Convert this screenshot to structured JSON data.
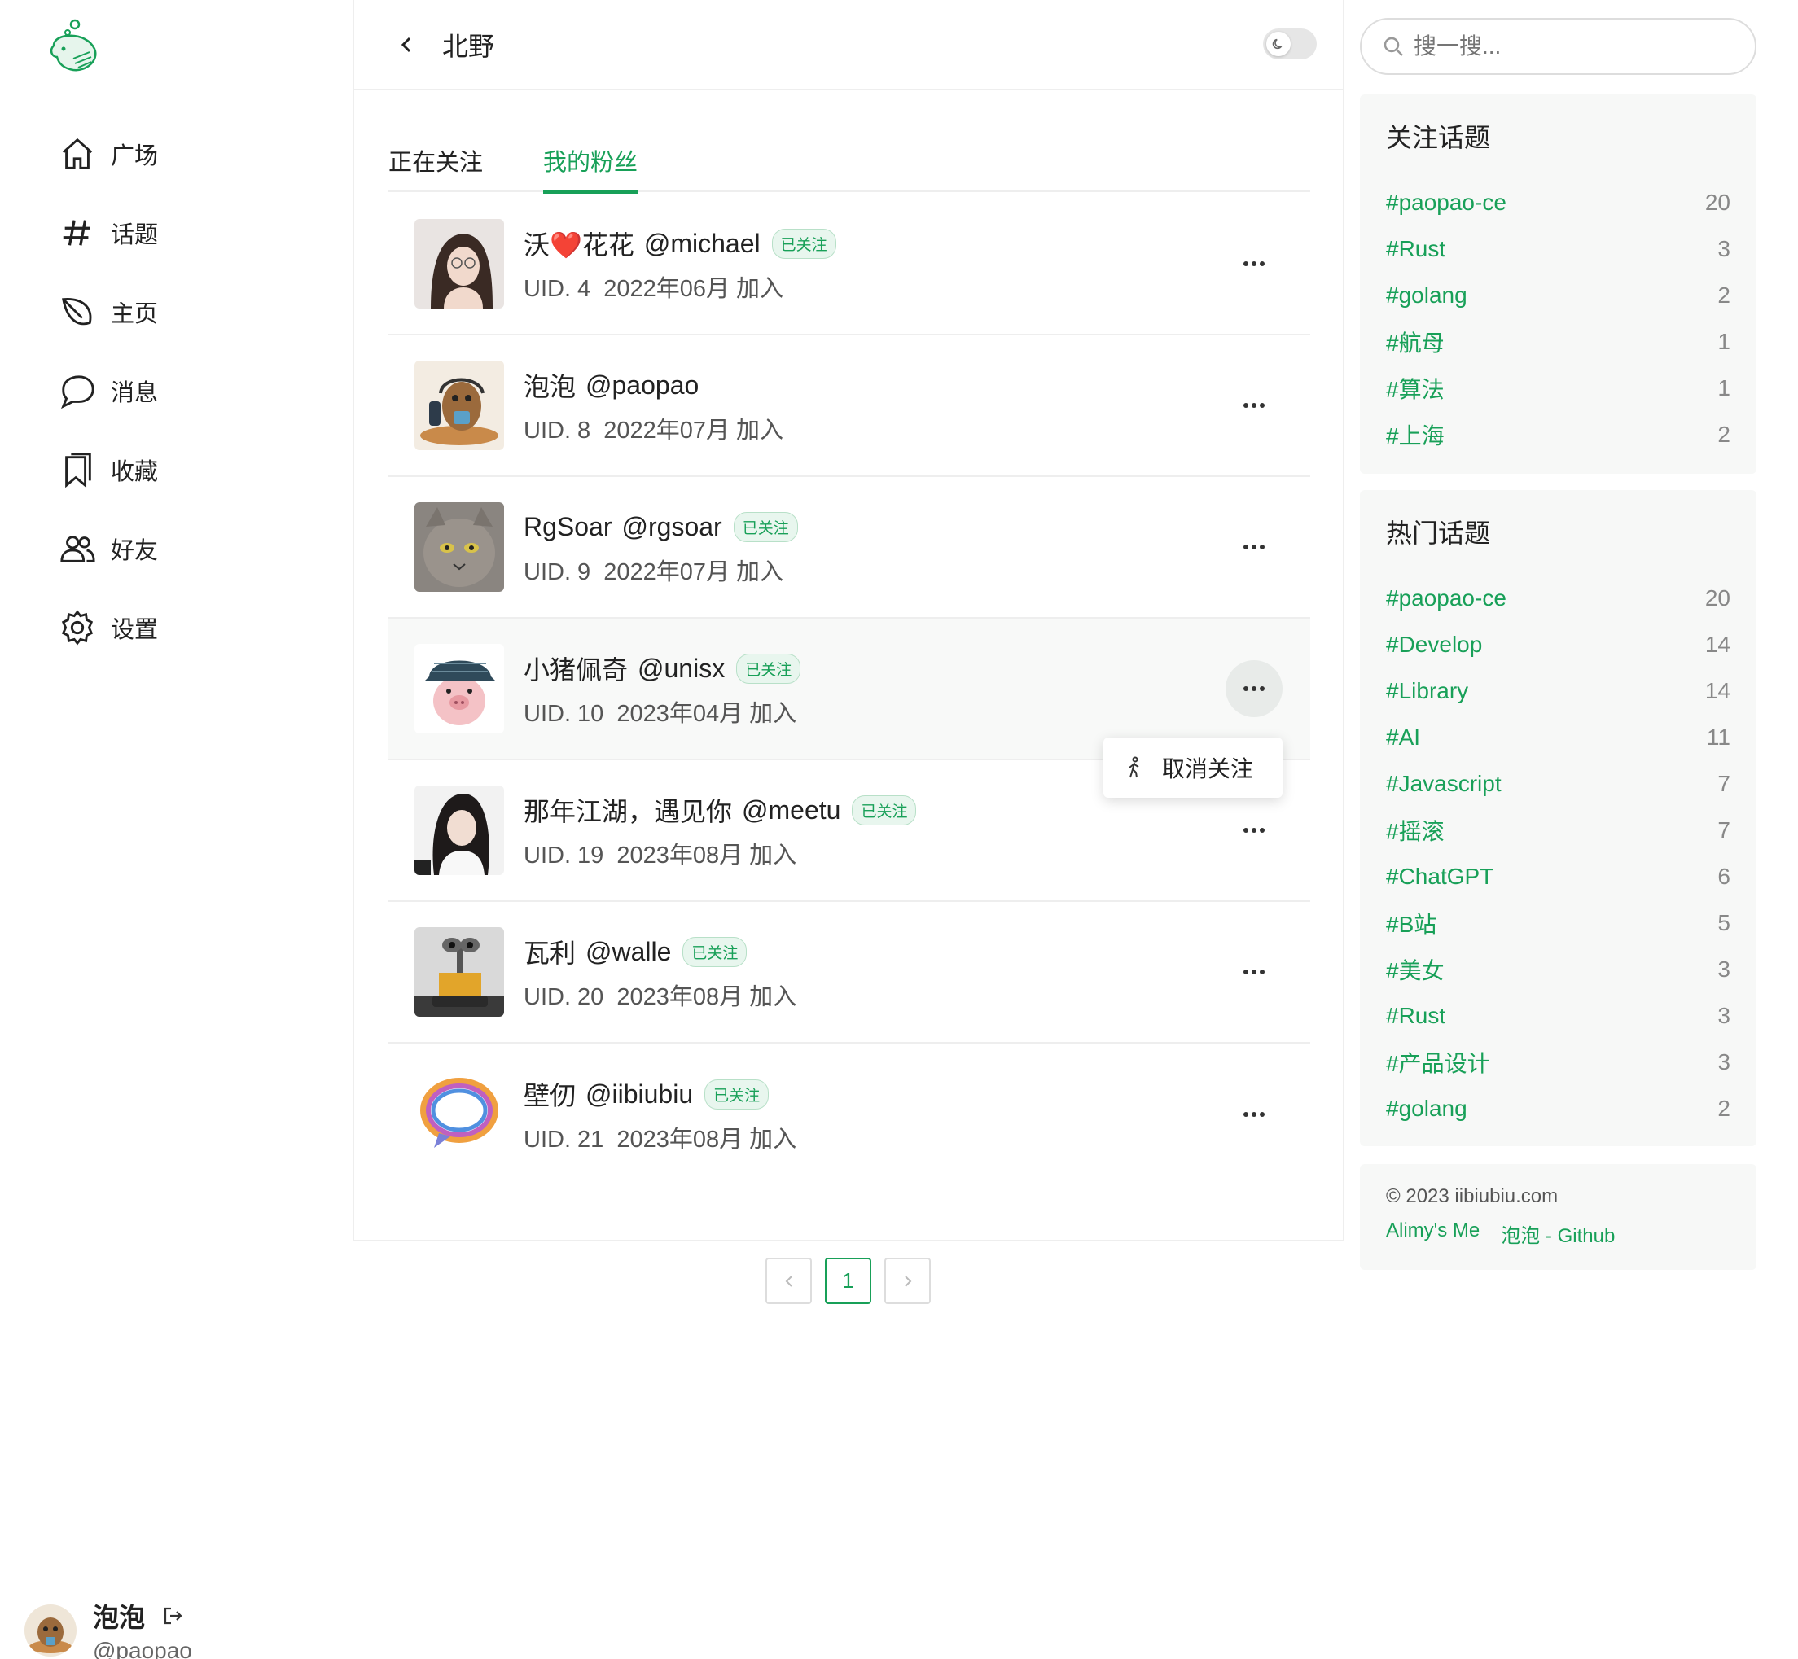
{
  "sidebar": {
    "nav": [
      {
        "label": "广场",
        "icon": "home-icon"
      },
      {
        "label": "话题",
        "icon": "hash-icon"
      },
      {
        "label": "主页",
        "icon": "leaf-icon"
      },
      {
        "label": "消息",
        "icon": "chat-icon"
      },
      {
        "label": "收藏",
        "icon": "bookmark-icon"
      },
      {
        "label": "好友",
        "icon": "users-icon"
      },
      {
        "label": "设置",
        "icon": "gear-icon"
      }
    ],
    "user": {
      "name": "泡泡",
      "handle": "@paopao"
    }
  },
  "header": {
    "title": "北野"
  },
  "tabs": [
    {
      "label": "正在关注",
      "active": false
    },
    {
      "label": "我的粉丝",
      "active": true
    }
  ],
  "users": [
    {
      "name": "沃❤️花花",
      "handle": "@michael",
      "badge": "已关注",
      "uid": "UID. 4",
      "joined": "2022年06月 加入"
    },
    {
      "name": "泡泡",
      "handle": "@paopao",
      "badge": "",
      "uid": "UID. 8",
      "joined": "2022年07月 加入"
    },
    {
      "name": "RgSoar",
      "handle": "@rgsoar",
      "badge": "已关注",
      "uid": "UID. 9",
      "joined": "2022年07月 加入"
    },
    {
      "name": "小猪佩奇",
      "handle": "@unisx",
      "badge": "已关注",
      "uid": "UID. 10",
      "joined": "2023年04月 加入"
    },
    {
      "name": "那年江湖，遇见你",
      "handle": "@meetu",
      "badge": "已关注",
      "uid": "UID. 19",
      "joined": "2023年08月 加入"
    },
    {
      "name": "瓦利",
      "handle": "@walle",
      "badge": "已关注",
      "uid": "UID. 20",
      "joined": "2023年08月 加入"
    },
    {
      "name": "壁仞",
      "handle": "@iibiubiu",
      "badge": "已关注",
      "uid": "UID. 21",
      "joined": "2023年08月 加入"
    }
  ],
  "dropdown": {
    "label": "取消关注"
  },
  "pagination": {
    "current": "1"
  },
  "search": {
    "placeholder": "搜一搜..."
  },
  "followed_topics": {
    "title": "关注话题",
    "items": [
      {
        "name": "#paopao-ce",
        "count": "20"
      },
      {
        "name": "#Rust",
        "count": "3"
      },
      {
        "name": "#golang",
        "count": "2"
      },
      {
        "name": "#航母",
        "count": "1"
      },
      {
        "name": "#算法",
        "count": "1"
      },
      {
        "name": "#上海",
        "count": "2"
      }
    ]
  },
  "hot_topics": {
    "title": "热门话题",
    "items": [
      {
        "name": "#paopao-ce",
        "count": "20"
      },
      {
        "name": "#Develop",
        "count": "14"
      },
      {
        "name": "#Library",
        "count": "14"
      },
      {
        "name": "#AI",
        "count": "11"
      },
      {
        "name": "#Javascript",
        "count": "7"
      },
      {
        "name": "#摇滚",
        "count": "7"
      },
      {
        "name": "#ChatGPT",
        "count": "6"
      },
      {
        "name": "#B站",
        "count": "5"
      },
      {
        "name": "#美女",
        "count": "3"
      },
      {
        "name": "#Rust",
        "count": "3"
      },
      {
        "name": "#产品设计",
        "count": "3"
      },
      {
        "name": "#golang",
        "count": "2"
      }
    ]
  },
  "footer": {
    "copyright": "© 2023 iibiubiu.com",
    "links": [
      "Alimy's Me",
      "泡泡 - Github"
    ]
  },
  "colors": {
    "accent": "#18a058"
  }
}
